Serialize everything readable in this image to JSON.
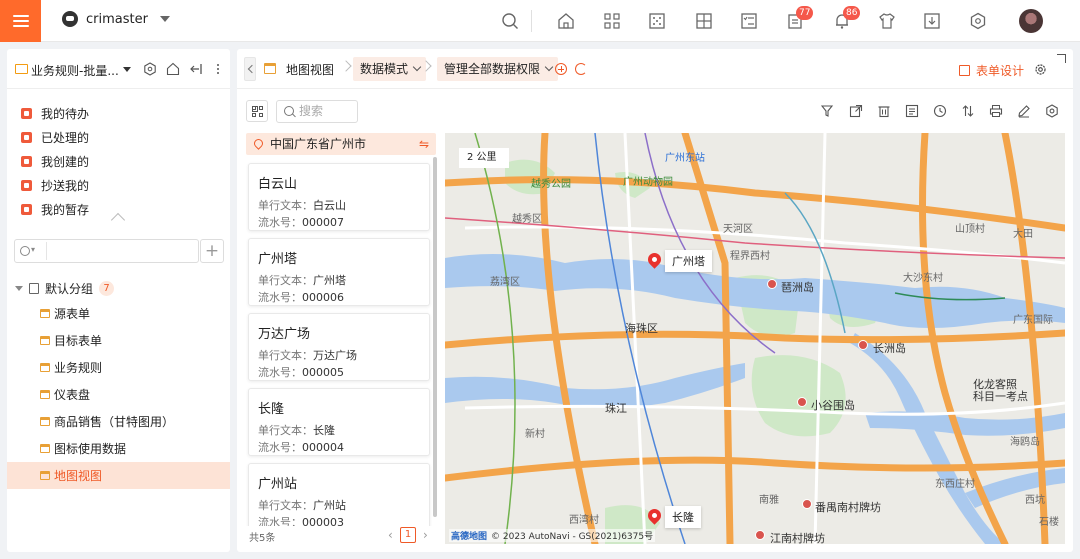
{
  "app": {
    "brand": "crimaster"
  },
  "topbar": {
    "notifications": [
      {
        "name": "tasks",
        "count": "77"
      },
      {
        "name": "bell",
        "count": "86"
      }
    ]
  },
  "sidebar": {
    "title": "业务规则-批量...",
    "quick": [
      {
        "label": "我的待办"
      },
      {
        "label": "已处理的"
      },
      {
        "label": "我创建的"
      },
      {
        "label": "抄送我的"
      },
      {
        "label": "我的暂存"
      }
    ],
    "search_placeholder": "",
    "group": {
      "label": "默认分组",
      "count": "7"
    },
    "items": [
      {
        "label": "源表单"
      },
      {
        "label": "目标表单"
      },
      {
        "label": "业务规则"
      },
      {
        "label": "仪表盘"
      },
      {
        "label": "商品销售（甘特图用）"
      },
      {
        "label": "图标使用数据"
      },
      {
        "label": "地图视图"
      }
    ]
  },
  "tabs": {
    "view": "地图视图",
    "mode": "数据模式",
    "permission": "管理全部数据权限",
    "form_design": "表单设计"
  },
  "toolbar": {
    "search_placeholder": "搜索"
  },
  "list": {
    "location": "中国广东省广州市",
    "field_text_label": "单行文本：",
    "field_serial_label": "流水号：",
    "cards": [
      {
        "title": "白云山",
        "text": "白云山",
        "serial": "000007"
      },
      {
        "title": "广州塔",
        "text": "广州塔",
        "serial": "000006"
      },
      {
        "title": "万达广场",
        "text": "万达广场",
        "serial": "000005"
      },
      {
        "title": "长隆",
        "text": "长隆",
        "serial": "000004"
      },
      {
        "title": "广州站",
        "text": "广州站",
        "serial": "000003"
      }
    ],
    "total": "共5条",
    "page": "1"
  },
  "map": {
    "scale": "2 公里",
    "markers": [
      {
        "label": "广州塔"
      },
      {
        "label": "长隆"
      }
    ],
    "labels": [
      "越秀公园",
      "广州东站",
      "广州动物园",
      "越秀区",
      "天河区",
      "程界西村",
      "荔湾区",
      "广州塔",
      "海珠区",
      "珠江",
      "琶洲岛",
      "长洲岛",
      "小谷围岛",
      "化龙客照",
      "科目一考点",
      "大沙东村",
      "广东国际",
      "山顶村",
      "大田",
      "番禺南村牌坊",
      "江南村牌坊",
      "长隆",
      "南雅",
      "东西庄村",
      "西坑",
      "石楼",
      "海鸥岛",
      "新村",
      "西湾村"
    ],
    "copyright_brand": "高德地图",
    "copyright": "© 2023 AutoNavi - GS(2021)6375号"
  }
}
